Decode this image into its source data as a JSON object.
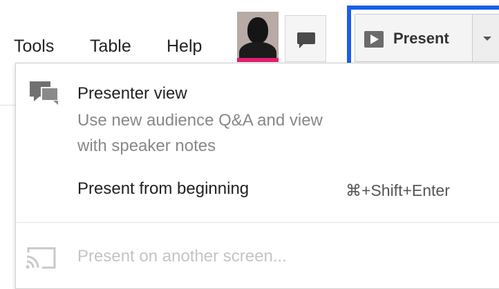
{
  "menubar": {
    "items": [
      "Tools",
      "Table",
      "Help"
    ]
  },
  "present_button": {
    "label": "Present"
  },
  "dropdown": {
    "presenter_view": {
      "title": "Presenter view",
      "description_line1": "Use new audience Q&A and view",
      "description_line2": "with speaker notes"
    },
    "present_from_beginning": {
      "title": "Present from beginning",
      "shortcut": "⌘+Shift+Enter"
    },
    "present_on_another_screen": {
      "title": "Present on another screen..."
    }
  },
  "colors": {
    "highlight": "#1a5ee8",
    "avatar_accent": "#e0206f"
  },
  "icons": {
    "comment": "comment-icon",
    "play": "play-icon",
    "presenter": "presenter-view-icon",
    "cast": "cast-icon",
    "caret": "chevron-down-icon"
  }
}
